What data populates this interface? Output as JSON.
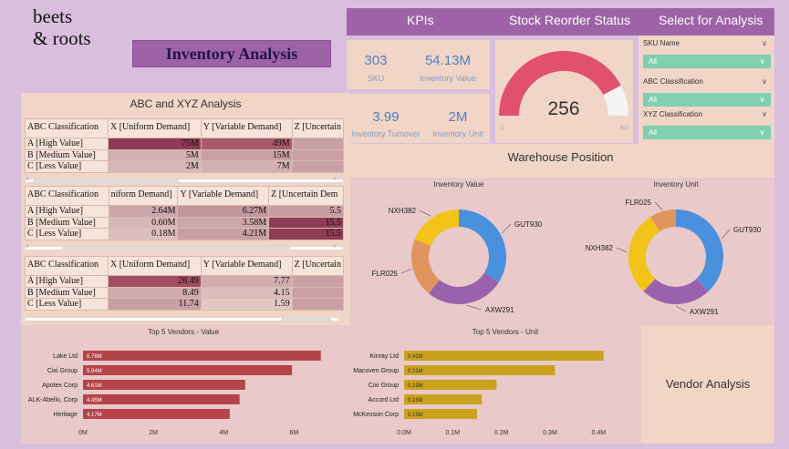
{
  "brand": "beets\n& roots",
  "title": "Inventory Analysis",
  "topbar": {
    "kpis": "KPIs",
    "stock": "Stock Reorder Status",
    "select": "Select for Analysis"
  },
  "kpi": {
    "sku_value": "303",
    "sku_label": "SKU",
    "inv_value": "54.13M",
    "inv_label": "Inventory Value",
    "turnover_value": "3.99",
    "turnover_label": "Inventory Turnover",
    "unit_value": "2M",
    "unit_label": "Inventory Unit"
  },
  "gauge": {
    "value": "256",
    "min": "0",
    "max": "303",
    "fraction": 0.845,
    "color_fill": "#e2516c",
    "color_rest": "#f4f4f4"
  },
  "slicers": [
    {
      "label": "SKU Name",
      "value": "All"
    },
    {
      "label": "ABC Classification",
      "value": "All"
    },
    {
      "label": "XYZ Classification",
      "value": "All"
    }
  ],
  "warehouse": "Warehouse Position",
  "abc_title": "ABC and XYZ Analysis",
  "matrices": [
    {
      "headers": [
        "ABC Classification",
        "X [Uniform Demand]",
        "Y [Variable Demand]",
        "Z [Uncertain"
      ],
      "rows": [
        {
          "label": "A [High Value]",
          "cells": [
            "75M",
            "49M",
            ""
          ]
        },
        {
          "label": "B [Medium Value]",
          "cells": [
            "5M",
            "15M",
            ""
          ]
        },
        {
          "label": "C [Less Value]",
          "cells": [
            "2M",
            "7M",
            ""
          ]
        }
      ]
    },
    {
      "headers": [
        "ABC Classification",
        "niform Demand]",
        "Y [Variable Demand]",
        "Z [Uncertain Dem"
      ],
      "rows": [
        {
          "label": "A [High Value]",
          "cells": [
            "2.64M",
            "6.27M",
            "5.5"
          ]
        },
        {
          "label": "B [Medium Value]",
          "cells": [
            "0.60M",
            "3.58M",
            "15.5"
          ]
        },
        {
          "label": "C [Less Value]",
          "cells": [
            "0.18M",
            "4.21M",
            "15.5"
          ]
        }
      ]
    },
    {
      "headers": [
        "ABC Classification",
        "X [Uniform Demand]",
        "Y [Variable Demand]",
        "Z [Uncertain"
      ],
      "rows": [
        {
          "label": "A [High Value]",
          "cells": [
            "28.49",
            "7.77",
            ""
          ]
        },
        {
          "label": "B [Medium Value]",
          "cells": [
            "8.49",
            "4.15",
            ""
          ]
        },
        {
          "label": "C [Less Value]",
          "cells": [
            "11.74",
            "1.59",
            ""
          ]
        }
      ]
    }
  ],
  "donuts": [
    {
      "title": "Inventory Value",
      "slices": [
        {
          "name": "GUT930",
          "value": 34,
          "color": "#4a90dd"
        },
        {
          "name": "AXW291",
          "value": 27,
          "color": "#9a62ad"
        },
        {
          "name": "FLR025",
          "value": 20,
          "color": "#e0955e"
        },
        {
          "name": "NXH382",
          "value": 19,
          "color": "#f2c419"
        }
      ]
    },
    {
      "title": "Inventory Unit",
      "slices": [
        {
          "name": "GUT930",
          "value": 38,
          "color": "#4a90dd"
        },
        {
          "name": "AXW291",
          "value": 24,
          "color": "#9a62ad"
        },
        {
          "name": "NXH382",
          "value": 29,
          "color": "#f2c419"
        },
        {
          "name": "FLR025",
          "value": 9,
          "color": "#e0955e"
        }
      ]
    }
  ],
  "chart_data": [
    {
      "type": "bar",
      "title": "Top 5 Vendors - Value",
      "categories": [
        "Lake Ltd",
        "Cixi Group",
        "Apotex Corp",
        "ALK-Abello, Corp",
        "Heritage"
      ],
      "values": [
        6.76,
        5.94,
        4.61,
        4.45,
        4.17
      ],
      "value_labels": [
        "6.76M",
        "5.94M",
        "4.61M",
        "4.45M",
        "4.17M"
      ],
      "xticks": [
        "0M",
        "2M",
        "4M",
        "6M"
      ],
      "xlim": [
        0,
        7
      ],
      "color": "#b5444a"
    },
    {
      "type": "bar",
      "title": "Top 5 Vendors - Unit",
      "categories": [
        "Kinray Ltd",
        "Macoven Group",
        "Cixi Group",
        "Accord Ltd",
        "McKesson Corp"
      ],
      "values": [
        0.41,
        0.31,
        0.19,
        0.16,
        0.15
      ],
      "value_labels": [
        "0.41M",
        "0.31M",
        "0.19M",
        "0.16M",
        "0.15M"
      ],
      "xticks": [
        "0.0M",
        "0.1M",
        "0.2M",
        "0.3M",
        "0.4M"
      ],
      "xlim": [
        0,
        0.45
      ],
      "color": "#c9a21e"
    }
  ],
  "vendor_analysis": "Vendor Analysis"
}
